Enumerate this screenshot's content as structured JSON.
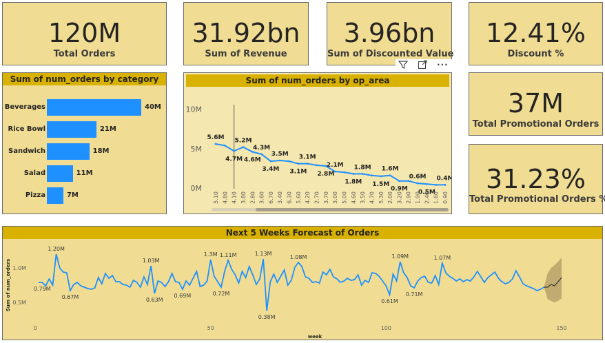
{
  "kpis": [
    {
      "value": "120M",
      "label": "Total Orders"
    },
    {
      "value": "31.92bn",
      "label": "Sum of Revenue"
    },
    {
      "value": "3.96bn",
      "label": "Sum of Discounted Value"
    },
    {
      "value": "12.41%",
      "label": "Discount %"
    },
    {
      "value": "37M",
      "label": "Total Promotional Orders"
    },
    {
      "value": "31.23%",
      "label": "Total Promotional Orders %"
    }
  ],
  "visual_header_icons": [
    "filter-icon",
    "focus-mode-icon",
    "more-options-icon"
  ],
  "chart_data": [
    {
      "type": "bar",
      "orientation": "horizontal",
      "title": "Sum of num_orders by category",
      "categories": [
        "Beverages",
        "Rice Bowl",
        "Sandwich",
        "Salad",
        "Pizza"
      ],
      "values": [
        40,
        21,
        18,
        11,
        7
      ],
      "data_labels": [
        "40M",
        "21M",
        "18M",
        "11M",
        "7M"
      ],
      "color": "#1e90ff"
    },
    {
      "type": "line",
      "title": "Sum of num_orders by op_area",
      "x": [
        "5.10",
        "4.80",
        "4.10",
        "3.80",
        "2.80",
        "3.60",
        "6.70",
        "3.40",
        "6.30",
        "5.60",
        "4.20",
        "2.70",
        "3.70",
        "3.00",
        "5.00",
        "4.60",
        "3.50",
        "4.70",
        "5.30",
        "2.00",
        "3.20",
        "2.90",
        "1.90",
        "2.40",
        "1.60",
        "0.90"
      ],
      "values": [
        5.6,
        5.4,
        4.7,
        5.2,
        4.6,
        4.3,
        3.4,
        3.5,
        3.4,
        3.1,
        3.1,
        2.9,
        2.8,
        2.1,
        2.0,
        1.8,
        1.8,
        1.6,
        1.5,
        1.6,
        0.9,
        0.9,
        0.6,
        0.5,
        0.4,
        0.4
      ],
      "data_labels": [
        {
          "i": 0,
          "text": "5.6M"
        },
        {
          "i": 2,
          "text": "4.7M"
        },
        {
          "i": 3,
          "text": "5.2M"
        },
        {
          "i": 4,
          "text": "4.6M"
        },
        {
          "i": 5,
          "text": "4.3M"
        },
        {
          "i": 6,
          "text": "3.4M"
        },
        {
          "i": 7,
          "text": "3.5M"
        },
        {
          "i": 9,
          "text": "3.1M"
        },
        {
          "i": 10,
          "text": "3.1M"
        },
        {
          "i": 12,
          "text": "2.8M"
        },
        {
          "i": 13,
          "text": "2.1M"
        },
        {
          "i": 15,
          "text": "1.8M"
        },
        {
          "i": 16,
          "text": "1.8M"
        },
        {
          "i": 18,
          "text": "1.5M"
        },
        {
          "i": 19,
          "text": "1.6M"
        },
        {
          "i": 20,
          "text": "0.9M"
        },
        {
          "i": 22,
          "text": "0.6M"
        },
        {
          "i": 23,
          "text": "0.5M"
        },
        {
          "i": 25,
          "text": "0.4M"
        }
      ],
      "yticks": [
        "10M",
        "5M",
        "0M"
      ],
      "ytick_values": [
        10,
        5,
        0
      ],
      "ylim": [
        0,
        10.5
      ],
      "highlight_index": 2,
      "color": "#1e90ff"
    },
    {
      "type": "line",
      "title": "Next 5 Weeks Forecast of Orders",
      "xlabel": "week",
      "ylabel": "Sum of num_orders",
      "xlim": [
        1,
        150
      ],
      "ylim": [
        0.3,
        1.3
      ],
      "xticks": [
        0,
        50,
        100,
        150
      ],
      "yticks": [
        {
          "v": 1.0,
          "t": "1.0M"
        },
        {
          "v": 0.5,
          "t": "0.5M"
        }
      ],
      "values": [
        0.79,
        0.79,
        0.74,
        0.84,
        0.75,
        1.2,
        1.0,
        0.94,
        0.93,
        0.67,
        0.76,
        0.79,
        0.74,
        0.72,
        0.7,
        0.69,
        0.71,
        0.86,
        0.77,
        0.92,
        0.85,
        0.89,
        0.8,
        0.8,
        0.76,
        0.75,
        0.72,
        0.82,
        0.79,
        0.72,
        0.87,
        0.76,
        1.03,
        0.63,
        0.81,
        0.79,
        0.73,
        0.8,
        0.92,
        0.8,
        0.79,
        0.69,
        0.81,
        0.75,
        0.85,
        0.95,
        0.73,
        0.75,
        0.81,
        1.12,
        0.88,
        0.8,
        0.72,
        0.95,
        1.11,
        0.98,
        0.9,
        0.78,
        0.95,
        0.86,
        1.02,
        0.9,
        0.76,
        0.84,
        1.13,
        0.38,
        0.8,
        0.91,
        0.79,
        0.88,
        0.97,
        0.75,
        0.82,
        1.01,
        1.08,
        1.02,
        0.87,
        0.85,
        0.79,
        0.8,
        0.78,
        0.94,
        0.9,
        0.98,
        0.87,
        0.84,
        0.79,
        0.81,
        0.85,
        0.82,
        0.83,
        0.9,
        0.75,
        0.82,
        0.79,
        0.93,
        0.92,
        0.88,
        0.81,
        0.74,
        0.61,
        0.91,
        0.81,
        1.09,
        0.93,
        0.86,
        0.74,
        0.71,
        0.81,
        0.86,
        0.88,
        0.79,
        0.78,
        0.89,
        0.76,
        1.07,
        0.93,
        0.88,
        0.85,
        0.81,
        0.84,
        0.8,
        0.83,
        0.81,
        0.87,
        0.95,
        0.87,
        0.79,
        0.86,
        0.9,
        0.94,
        0.85,
        0.8,
        0.77,
        0.79,
        0.84,
        0.96,
        0.87,
        0.77,
        0.74,
        0.72,
        0.7,
        0.67,
        0.69,
        0.72
      ],
      "data_labels": [
        {
          "i": 1,
          "text": "0.79M"
        },
        {
          "i": 5,
          "text": "1.20M"
        },
        {
          "i": 9,
          "text": "0.67M"
        },
        {
          "i": 32,
          "text": "1.03M"
        },
        {
          "i": 33,
          "text": "0.63M"
        },
        {
          "i": 41,
          "text": "0.69M"
        },
        {
          "i": 49,
          "text": "1.3M"
        },
        {
          "i": 52,
          "text": "0.72M"
        },
        {
          "i": 54,
          "text": "1.11M"
        },
        {
          "i": 64,
          "text": "1.13M"
        },
        {
          "i": 65,
          "text": "0.38M"
        },
        {
          "i": 74,
          "text": "1.08M"
        },
        {
          "i": 100,
          "text": "0.61M"
        },
        {
          "i": 103,
          "text": "1.09M"
        },
        {
          "i": 107,
          "text": "0.71M"
        },
        {
          "i": 115,
          "text": "1.07M"
        },
        {
          "i": 145,
          "text": "0.67M"
        }
      ],
      "forecast": {
        "weeks": [
          146,
          147,
          148,
          149,
          150
        ],
        "values": [
          0.72,
          0.76,
          0.74,
          0.8,
          0.86
        ],
        "lower": [
          0.55,
          0.52,
          0.5,
          0.52,
          0.56
        ],
        "upper": [
          0.92,
          1.0,
          1.04,
          1.09,
          1.15
        ]
      },
      "color": "#1e90ff",
      "forecast_color": "#333333",
      "band_color": "#b8a26a"
    }
  ],
  "colors": {
    "card_bg": "#f0dd93",
    "header_bg": "#d9b100",
    "bar": "#1e90ff"
  }
}
